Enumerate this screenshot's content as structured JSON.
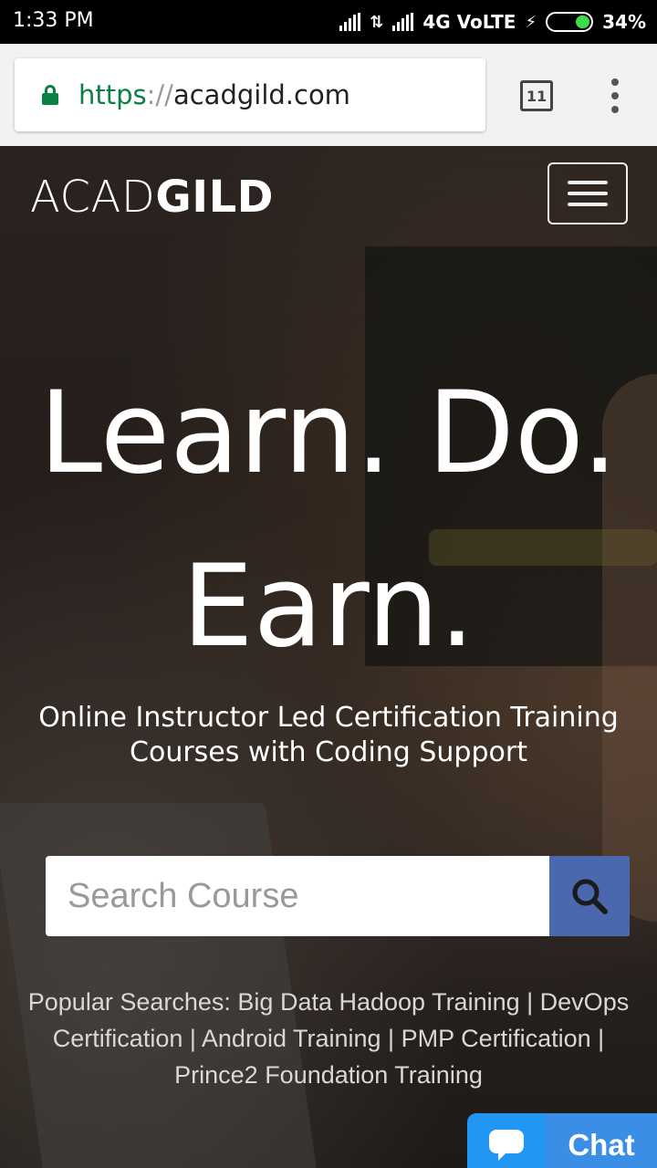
{
  "status_bar": {
    "time": "1:33 PM",
    "network": "4G VoLTE",
    "battery": "34%",
    "battery_level": 0.34,
    "icons": [
      "signal-icon",
      "data-arrows-icon",
      "signal-icon",
      "charging-icon",
      "battery-icon"
    ]
  },
  "browser": {
    "url_scheme": "https",
    "url_sep": "://",
    "url_host": "acadgild.com",
    "tab_count": "11",
    "colors": {
      "secure": "#0b8043"
    }
  },
  "site": {
    "logo_light": "ACAD",
    "logo_bold": "GILD",
    "headline_line1": "Learn. Do.",
    "headline_line2": "Earn.",
    "subtitle_line1": "Online Instructor Led Certification Training",
    "subtitle_line2": "Courses with Coding Support",
    "search": {
      "placeholder": "Search Course",
      "value": ""
    },
    "popular": {
      "prefix": "Popular Searches:",
      "sep": "|",
      "items": [
        "Big Data Hadoop Training",
        "DevOps Certification",
        "Android Training",
        "PMP Certification",
        "Prince2 Foundation Training"
      ]
    },
    "chat_label": "Chat",
    "colors": {
      "search_button": "#4a68ad",
      "chat": "#2196f3"
    }
  }
}
